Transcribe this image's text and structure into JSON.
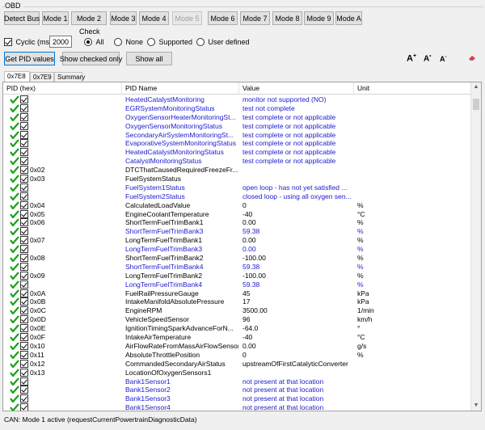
{
  "group": {
    "title": "OBD"
  },
  "buttons": {
    "detect_bus": "Detect Bus",
    "modes": [
      "Mode 1",
      "Mode 2",
      "Mode 3",
      "Mode 4",
      "Mode 5",
      "Mode 6",
      "Mode 7",
      "Mode 8",
      "Mode 9",
      "Mode A"
    ]
  },
  "cyclic": {
    "label": "Cyclic (ms)",
    "value": "2000",
    "checked": true
  },
  "check": {
    "title": "Check",
    "options": [
      "All",
      "None",
      "Supported",
      "User defined"
    ],
    "selected": "All"
  },
  "actions": {
    "get_pid": "Get PID values",
    "show_checked": "Show checked only",
    "show_all": "Show all"
  },
  "font_tools": {
    "increase": "A",
    "reset": "A",
    "decrease": "A"
  },
  "tabs": [
    "0x7E8",
    "0x7E9",
    "Summary"
  ],
  "table": {
    "headers": [
      "PID (hex)",
      "PID Name",
      "Value",
      "Unit"
    ],
    "rows": [
      {
        "pid": "",
        "name": "HeatedCatalystMonitoring",
        "value": "monitor not supported (NO)",
        "unit": "",
        "blue": true
      },
      {
        "pid": "",
        "name": "EGRSystemMonitoringStatus",
        "value": "test not complete",
        "unit": "",
        "blue": true
      },
      {
        "pid": "",
        "name": "OxygenSensorHeaterMonitoringSt...",
        "value": "test complete or not applicable",
        "unit": "",
        "blue": true
      },
      {
        "pid": "",
        "name": "OxygenSensorMonitoringStatus",
        "value": "test complete or not applicable",
        "unit": "",
        "blue": true
      },
      {
        "pid": "",
        "name": "SecondaryAirSystemMonitoringSt...",
        "value": "test complete or not applicable",
        "unit": "",
        "blue": true
      },
      {
        "pid": "",
        "name": "EvaporativeSystemMonitoringStatus",
        "value": "test complete or not applicable",
        "unit": "",
        "blue": true
      },
      {
        "pid": "",
        "name": "HeatedCatalystMonitoringStatus",
        "value": "test complete or not applicable",
        "unit": "",
        "blue": true
      },
      {
        "pid": "",
        "name": "CatalystMonitoringStatus",
        "value": "test complete or not applicable",
        "unit": "",
        "blue": true
      },
      {
        "pid": "0x02",
        "name": "DTCThatCausedRequiredFreezeFr...",
        "value": "",
        "unit": "",
        "blue": false
      },
      {
        "pid": "0x03",
        "name": "FuelSystemStatus",
        "value": "",
        "unit": "",
        "blue": false
      },
      {
        "pid": "",
        "name": "FuelSystem1Status",
        "value": "open loop - has not yet satisfied ...",
        "unit": "",
        "blue": true
      },
      {
        "pid": "",
        "name": "FuelSystem2Status",
        "value": "closed loop - using all oxygen sen...",
        "unit": "",
        "blue": true
      },
      {
        "pid": "0x04",
        "name": "CalculatedLoadValue",
        "value": "0",
        "unit": "%",
        "blue": false
      },
      {
        "pid": "0x05",
        "name": "EngineCoolantTemperature",
        "value": "-40",
        "unit": "°C",
        "blue": false
      },
      {
        "pid": "0x06",
        "name": "ShortTermFuelTrimBank1",
        "value": "0.00",
        "unit": "%",
        "blue": false
      },
      {
        "pid": "",
        "name": "ShortTermFuelTrimBank3",
        "value": "59.38",
        "unit": "%",
        "blue": true
      },
      {
        "pid": "0x07",
        "name": "LongTermFuelTrimBank1",
        "value": "0.00",
        "unit": "%",
        "blue": false
      },
      {
        "pid": "",
        "name": "LongTermFuelTrimBank3",
        "value": "0.00",
        "unit": "%",
        "blue": true
      },
      {
        "pid": "0x08",
        "name": "ShortTermFuelTrimBank2",
        "value": "-100.00",
        "unit": "%",
        "blue": false
      },
      {
        "pid": "",
        "name": "ShortTermFuelTrimBank4",
        "value": "59.38",
        "unit": "%",
        "blue": true
      },
      {
        "pid": "0x09",
        "name": "LongTermFuelTrimBank2",
        "value": "-100.00",
        "unit": "%",
        "blue": false
      },
      {
        "pid": "",
        "name": "LongTermFuelTrimBank4",
        "value": "59.38",
        "unit": "%",
        "blue": true
      },
      {
        "pid": "0x0A",
        "name": "FuelRailPressureGauge",
        "value": "45",
        "unit": "kPa",
        "blue": false
      },
      {
        "pid": "0x0B",
        "name": "IntakeManifoldAbsolutePressure",
        "value": "17",
        "unit": "kPa",
        "blue": false
      },
      {
        "pid": "0x0C",
        "name": "EngineRPM",
        "value": "3500.00",
        "unit": "1/min",
        "blue": false
      },
      {
        "pid": "0x0D",
        "name": "VehicleSpeedSensor",
        "value": "96",
        "unit": "km/h",
        "blue": false
      },
      {
        "pid": "0x0E",
        "name": "IgnitionTimingSparkAdvanceForN...",
        "value": "-64.0",
        "unit": "°",
        "blue": false
      },
      {
        "pid": "0x0F",
        "name": "IntakeAirTemperature",
        "value": "-40",
        "unit": "°C",
        "blue": false
      },
      {
        "pid": "0x10",
        "name": "AirFlowRateFromMassAirFlowSensor",
        "value": "0.00",
        "unit": "g/s",
        "blue": false
      },
      {
        "pid": "0x11",
        "name": "AbsoluteThrottlePosition",
        "value": "0",
        "unit": "%",
        "blue": false
      },
      {
        "pid": "0x12",
        "name": "CommandedSecondaryAirStatus",
        "value": "upstreamOfFirstCatalyticConverter",
        "unit": "",
        "blue": false
      },
      {
        "pid": "0x13",
        "name": "LocationOfOxygenSensors1",
        "value": "",
        "unit": "",
        "blue": false
      },
      {
        "pid": "",
        "name": "Bank1Sensor1",
        "value": "not present at that location",
        "unit": "",
        "blue": true
      },
      {
        "pid": "",
        "name": "Bank1Sensor2",
        "value": "not present at that location",
        "unit": "",
        "blue": true
      },
      {
        "pid": "",
        "name": "Bank1Sensor3",
        "value": "not present at that location",
        "unit": "",
        "blue": true
      },
      {
        "pid": "",
        "name": "Bank1Sensor4",
        "value": "not present at that location",
        "unit": "",
        "blue": true
      }
    ]
  },
  "status": "CAN: Mode 1 active (requestCurrentPowertrainDiagnosticData)",
  "colors": {
    "tick": "#1aa01a",
    "blue_text": "#1a1ad0"
  }
}
